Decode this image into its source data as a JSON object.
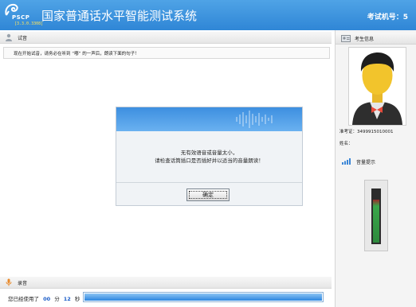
{
  "header": {
    "brand": "PSCP",
    "version": "[3.3.0.3308]",
    "title": "国家普通话水平智能测试系统",
    "exam_number_label": "考试机号：5"
  },
  "exam": {
    "section_label": "试音",
    "instruction": "现在开始试音，请务必在听到 “嘟” 的一声后，朗读下面的句子！"
  },
  "dialog": {
    "line1": "无有效语音或音量太小，",
    "line2": "请检查话筒插口是否插好并以适当的音量朗读！",
    "ok_label": "确定"
  },
  "recording": {
    "section_label": "录音",
    "elapsed_prefix": "您已经使用了",
    "minutes": "00",
    "minutes_unit": "分",
    "seconds": "12",
    "seconds_unit": "秒",
    "progress": 1.0
  },
  "side": {
    "candidate_title": "考生信息",
    "admission_label": "准考证：3499915010001",
    "name_label": "姓名：",
    "volume_title": "音量提示",
    "volume_level": 0.82
  },
  "colors": {
    "header_blue": "#2f86d6",
    "timer_blue": "#1a5cc8",
    "meter_green": "#3aa64a",
    "meter_red": "#9a2a2a"
  }
}
